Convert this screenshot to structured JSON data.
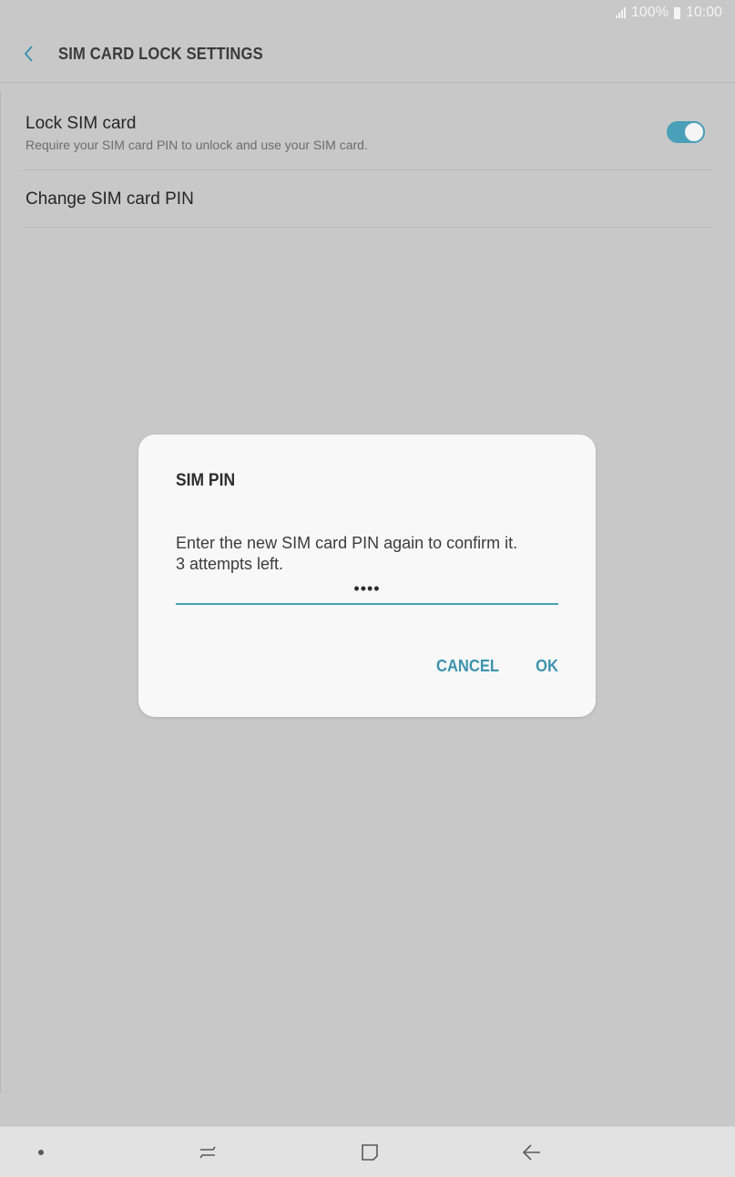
{
  "status_bar": {
    "battery": "100%",
    "time": "10:00"
  },
  "app_bar": {
    "title": "SIM CARD LOCK SETTINGS"
  },
  "settings": {
    "lock_sim": {
      "title": "Lock SIM card",
      "subtitle": "Require your SIM card PIN to unlock and use your SIM card.",
      "enabled": true
    },
    "change_pin": {
      "title": "Change SIM card PIN"
    }
  },
  "dialog": {
    "title": "SIM PIN",
    "message_line1": "Enter the new SIM card PIN again to confirm it.",
    "message_line2": "3 attempts left.",
    "pin_value": "••••",
    "cancel_label": "CANCEL",
    "ok_label": "OK"
  },
  "colors": {
    "accent": "#4aa0b8",
    "scrim_background": "#c8c8c8",
    "dialog_background": "#f8f8f8"
  },
  "icons": {
    "back": "back-chevron-icon",
    "nav_dot": "nav-dot-icon",
    "recents": "recents-icon",
    "home": "home-icon",
    "nav_back": "back-arrow-icon"
  }
}
